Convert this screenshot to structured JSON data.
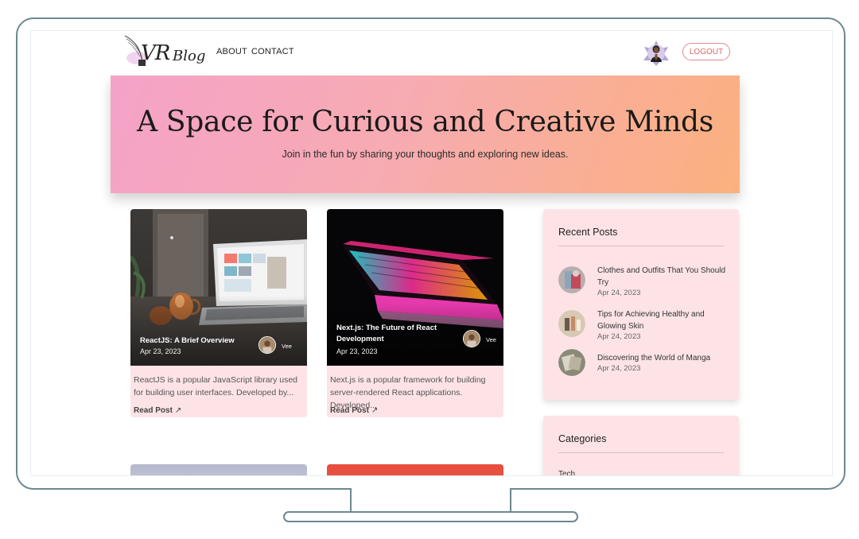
{
  "nav": {
    "logo_text": "VR",
    "logo_sub": "Blog",
    "links": [
      "ABOUT",
      "CONTACT"
    ],
    "logout_label": "LOGOUT"
  },
  "hero": {
    "title": "A Space for Curious and Creative Minds",
    "subtitle": "Join in the fun by sharing your thoughts and exploring new ideas."
  },
  "posts": [
    {
      "title": "ReactJS: A Brief Overview",
      "date": "Apr 23, 2023",
      "author": "Vee",
      "excerpt": "ReactJS is a popular JavaScript library used for building user interfaces. Developed by...",
      "read_label": "Read Post"
    },
    {
      "title": "Next.js: The Future of React Development",
      "date": "Apr 23, 2023",
      "author": "Vee",
      "excerpt": "Next.js is a popular framework for building server-rendered React applications. Developed...",
      "read_label": "Read Post"
    }
  ],
  "sidebar": {
    "recent_heading": "Recent Posts",
    "recent_posts": [
      {
        "title": "Clothes and Outfits That You Should Try",
        "date": "Apr 24, 2023"
      },
      {
        "title": "Tips for Achieving Healthy and Glowing Skin",
        "date": "Apr 24, 2023"
      },
      {
        "title": "Discovering the World of Manga",
        "date": "Apr 24, 2023"
      }
    ],
    "categories_heading": "Categories",
    "categories": [
      "Tech"
    ]
  },
  "colors": {
    "card_bg": "#fde3e6",
    "logout_accent": "#d86a6a",
    "hero_gradient_start": "#f5a2c8",
    "hero_gradient_end": "#fbb17e"
  }
}
